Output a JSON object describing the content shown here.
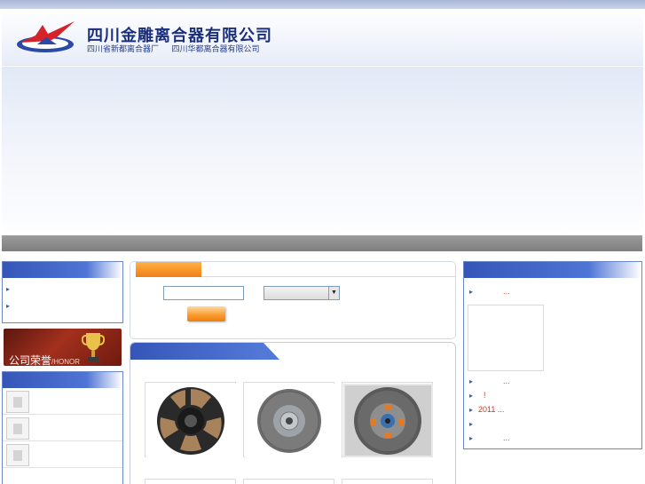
{
  "header": {
    "company_name": "四川金雕离合器有限公司",
    "sub_names": [
      "四川省新都离合器厂",
      "四川华都离合器有限公司"
    ],
    "logo_icon": "eagle-logo-icon"
  },
  "honor": {
    "title": "公司荣誉",
    "subtitle": "/HONOR"
  },
  "right_news": {
    "items": [
      "...",
      "...",
      "!",
      "2011 ...",
      "",
      "..."
    ]
  },
  "colors": {
    "panel_blue": "#3556b8",
    "accent_orange": "#f07c13",
    "nav_gray": "#8a8a8a",
    "link_red": "#c0392b"
  }
}
